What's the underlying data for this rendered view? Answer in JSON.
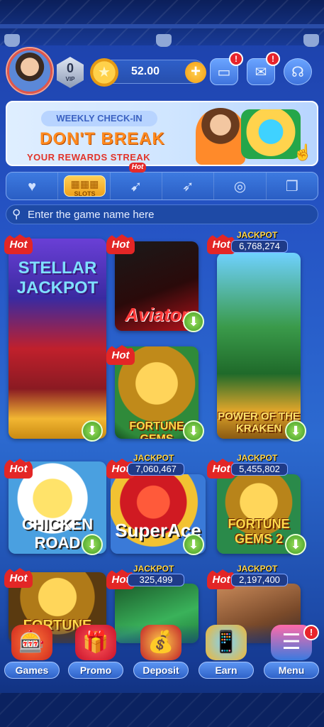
{
  "header": {
    "vip_level": "0",
    "vip_label": "VIP",
    "balance": "52.00",
    "wallet_badge": "!",
    "mail_badge": "!"
  },
  "banner": {
    "tag": "WEEKLY CHECK-IN",
    "headline": "DON'T BREAK",
    "subline": "YOUR REWARDS STREAK"
  },
  "categories": [
    {
      "name": "favorites",
      "icon": "heart-icon"
    },
    {
      "name": "slots",
      "label": "SLOTS",
      "icon": "slot-machine-icon"
    },
    {
      "name": "fishing",
      "icon": "fish-icon",
      "hot": "Hot"
    },
    {
      "name": "crash",
      "icon": "rocket-icon"
    },
    {
      "name": "table",
      "icon": "roulette-icon"
    },
    {
      "name": "cards",
      "icon": "cards-icon"
    }
  ],
  "search": {
    "placeholder": "Enter the game name here"
  },
  "hot_label": "Hot",
  "jackpot_label": "JACKPOT",
  "games": [
    {
      "id": "stellar-jackpot",
      "title": "STELLAR JACKPOT",
      "hot": true
    },
    {
      "id": "aviator",
      "title": "Aviator",
      "hot": true
    },
    {
      "id": "power-of-the-kraken",
      "title": "POWER OF THE KRAKEN",
      "hot": true,
      "jackpot": "6,768,274"
    },
    {
      "id": "500-fortune-gems",
      "title": "FORTUNE GEMS",
      "hot": true
    },
    {
      "id": "chicken-road",
      "title": "CHICKEN ROAD",
      "hot": true
    },
    {
      "id": "super-ace",
      "title": "SuperAce",
      "hot": true,
      "jackpot": "7,060,467"
    },
    {
      "id": "fortune-gems-2",
      "title": "FORTUNE GEMS 2",
      "hot": true,
      "jackpot": "5,455,802"
    },
    {
      "id": "fortune-gems-3",
      "title": "FORTUNE",
      "hot": true
    },
    {
      "id": "money-game",
      "title": "",
      "hot": true,
      "jackpot": "325,499"
    },
    {
      "id": "wild-game",
      "title": "",
      "hot": true,
      "jackpot": "2,197,400"
    }
  ],
  "nav": {
    "games": "Games",
    "promo": "Promo",
    "deposit": "Deposit",
    "earn": "Earn",
    "menu": "Menu",
    "menu_badge": "!"
  },
  "colors": {
    "background": "#2553c4",
    "accent_gold": "#f0a11b",
    "hot_red": "#e32626",
    "download_green": "#3e9b25"
  }
}
